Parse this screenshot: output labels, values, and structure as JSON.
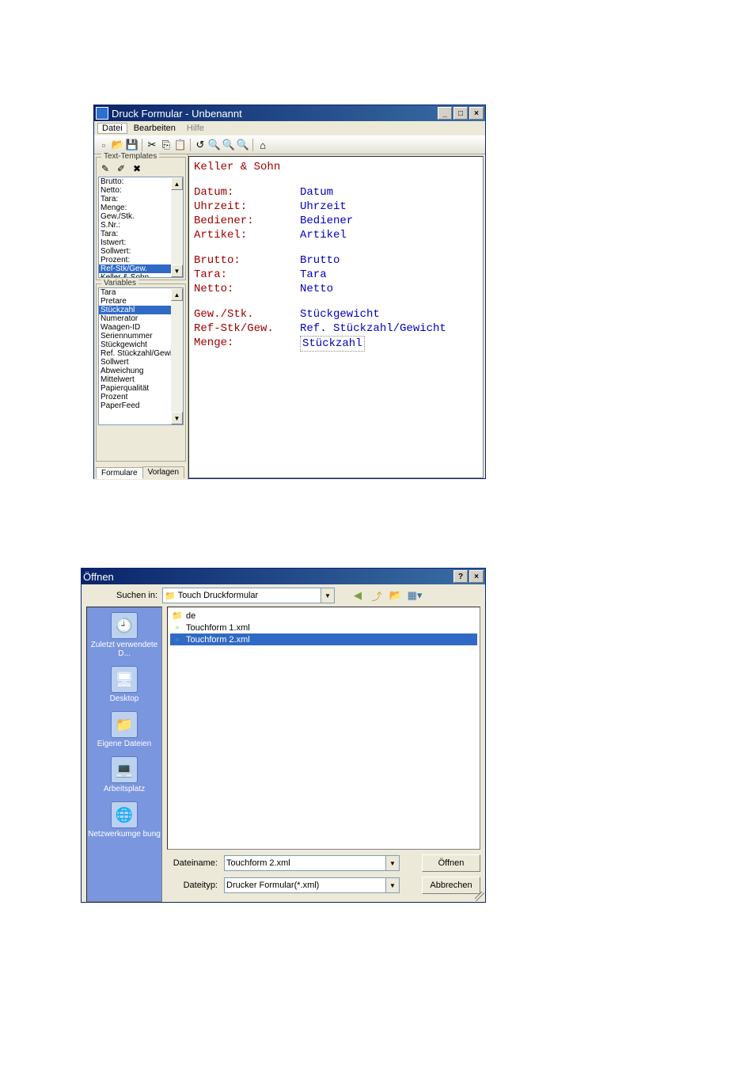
{
  "window1": {
    "title": "Druck Formular - Unbenannt",
    "menu": {
      "datei": "Datei",
      "bearbeiten": "Bearbeiten",
      "hilfe": "Hilfe"
    },
    "groups": {
      "templates": "Text-Templates",
      "variables": "Variables"
    },
    "templates_list": [
      "Brutto:",
      "Netto:",
      "Tara:",
      "Menge:",
      "Gew./Stk.",
      "S.Nr.:",
      "Tara:",
      "Istwert:",
      "Sollwert:",
      "Prozent:",
      "Ref-Stk/Gew.",
      "Keller & Sohn"
    ],
    "templates_selected": "Ref-Stk/Gew.",
    "variables_list": [
      "Tara",
      "Pretare",
      "Stückzahl",
      "Numerator",
      "Waagen-ID",
      "Seriennummer",
      "Stückgewicht",
      "Ref. Stückzahl/Gewich",
      "Sollwert",
      "Abweichung",
      "Mittelwert",
      "Papierqualität",
      "Prozent",
      "PaperFeed"
    ],
    "variables_selected": "Stückzahl",
    "tabs": {
      "formulare": "Formulare",
      "vorlagen": "Vorlagen"
    },
    "preview": {
      "header": "Keller & Sohn",
      "rows": [
        {
          "label": "Datum:",
          "value": "Datum"
        },
        {
          "label": "Uhrzeit:",
          "value": "Uhrzeit"
        },
        {
          "label": "Bediener:",
          "value": "Bediener"
        },
        {
          "label": "Artikel:",
          "value": "Artikel"
        }
      ],
      "rows2": [
        {
          "label": "Brutto:",
          "value": "Brutto"
        },
        {
          "label": "Tara:",
          "value": "Tara"
        },
        {
          "label": "Netto:",
          "value": "Netto"
        }
      ],
      "rows3": [
        {
          "label": "Gew./Stk.",
          "value": "Stückgewicht"
        },
        {
          "label": "Ref-Stk/Gew.",
          "value": "Ref. Stückzahl/Gewicht"
        }
      ],
      "menge_label": "Menge:",
      "menge_value": "Stückzahl"
    }
  },
  "window2": {
    "title": "Öffnen",
    "lookin_label": "Suchen in:",
    "lookin_value": "Touch Druckformular",
    "places": [
      "Zuletzt verwendete D...",
      "Desktop",
      "Eigene Dateien",
      "Arbeitsplatz",
      "Netzwerkumge bung"
    ],
    "files": [
      {
        "name": "de",
        "type": "folder"
      },
      {
        "name": "Touchform 1.xml",
        "type": "file"
      },
      {
        "name": "Touchform 2.xml",
        "type": "file"
      }
    ],
    "file_selected": "Touchform 2.xml",
    "filename_label": "Dateiname:",
    "filename_value": "Touchform 2.xml",
    "filetype_label": "Dateityp:",
    "filetype_value": "Drucker Formular(*.xml)",
    "open_btn": "Öffnen",
    "cancel_btn": "Abbrechen"
  }
}
